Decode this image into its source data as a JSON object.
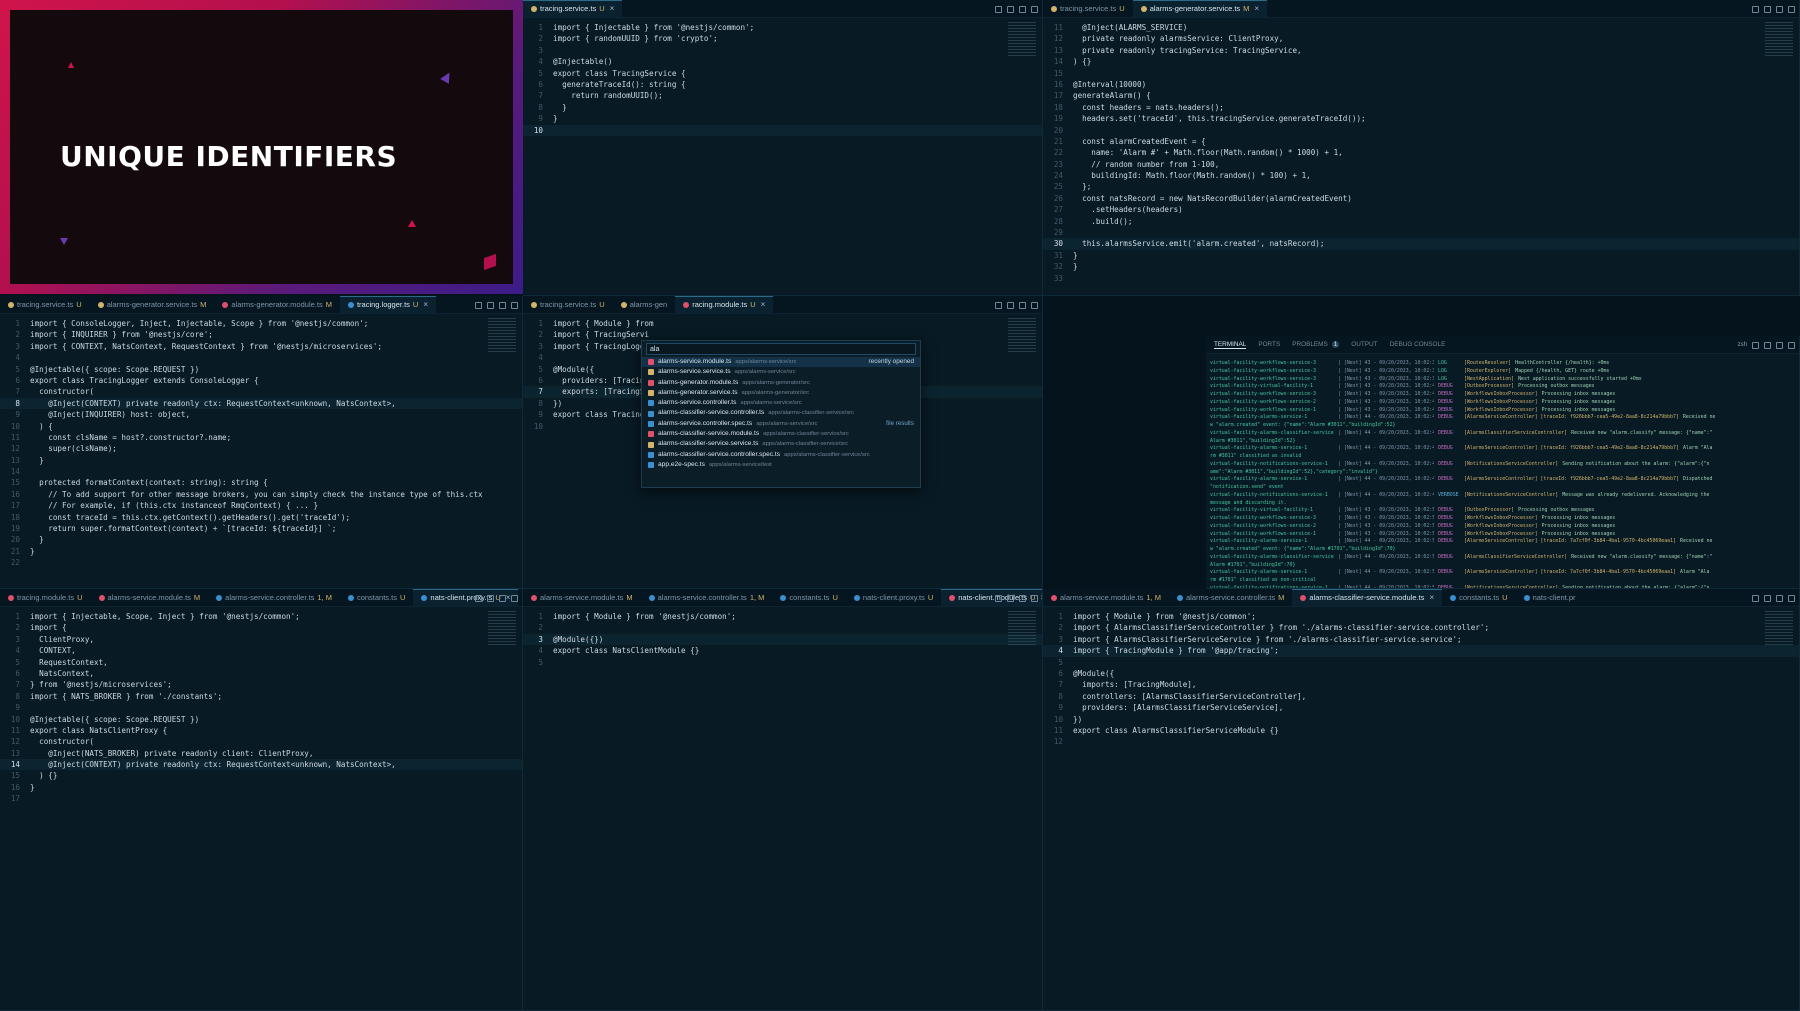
{
  "video": {
    "title": "UNIQUE IDENTIFIERS"
  },
  "panes": [
    {
      "id": "p1",
      "tabs": [
        {
          "label": "tracing.service.ts",
          "badge": "U",
          "active": true,
          "icon": "#d5b36a",
          "close": true
        }
      ],
      "active_line": 10,
      "lines": [
        "import { Injectable } from '@nestjs/common';",
        "import { randomUUID } from 'crypto';",
        "",
        "@Injectable()",
        "export class TracingService {",
        "  generateTraceId(): string {",
        "    return randomUUID();",
        "  }",
        "}",
        ""
      ]
    },
    {
      "id": "p2",
      "tabs": [
        {
          "label": "tracing.service.ts",
          "badge": "U",
          "active": false,
          "icon": "#d5b36a"
        },
        {
          "label": "alarms-generator.service.ts",
          "badge": "M",
          "active": true,
          "icon": "#d5b36a",
          "close": true
        }
      ],
      "start": 11,
      "active_line": 30,
      "lines": [
        "  @Inject(ALARMS_SERVICE)",
        "  private readonly alarmsService: ClientProxy,",
        "  private readonly tracingService: TracingService,",
        ") {}",
        "",
        "@Interval(10000)",
        "generateAlarm() {",
        "  const headers = nats.headers();",
        "  headers.set('traceId', this.tracingService.generateTraceId());",
        "",
        "  const alarmCreatedEvent = {",
        "    name: 'Alarm #' + Math.floor(Math.random() * 1000) + 1,",
        "    // random number from 1-100,",
        "    buildingId: Math.floor(Math.random() * 100) + 1,",
        "  };",
        "  const natsRecord = new NatsRecordBuilder(alarmCreatedEvent)",
        "    .setHeaders(headers)",
        "    .build();",
        "",
        "  this.alarmsService.emit('alarm.created', natsRecord);",
        "}",
        "}",
        ""
      ]
    },
    {
      "id": "p3",
      "tabs": [
        {
          "label": "tracing.service.ts",
          "badge": "U",
          "active": false,
          "icon": "#d5b36a"
        },
        {
          "label": "alarms-generator.service.ts",
          "badge": "M",
          "active": false,
          "icon": "#d5b36a"
        },
        {
          "label": "alarms-generator.module.ts",
          "badge": "M",
          "active": false,
          "icon": "#e0506a"
        },
        {
          "label": "tracing.logger.ts",
          "badge": "U",
          "active": true,
          "icon": "#3a8fd0",
          "close": true
        }
      ],
      "active_line": 8,
      "lines": [
        "import { ConsoleLogger, Inject, Injectable, Scope } from '@nestjs/common';",
        "import { INQUIRER } from '@nestjs/core';",
        "import { CONTEXT, NatsContext, RequestContext } from '@nestjs/microservices';",
        "",
        "@Injectable({ scope: Scope.REQUEST })",
        "export class TracingLogger extends ConsoleLogger {",
        "  constructor(",
        "    @Inject(CONTEXT) private readonly ctx: RequestContext<unknown, NatsContext>,",
        "    @Inject(INQUIRER) host: object,",
        "  ) {",
        "    const clsName = host?.constructor?.name;",
        "    super(clsName);",
        "  }",
        "",
        "  protected formatContext(context: string): string {",
        "    // To add support for other message brokers, you can simply check the instance type of this.ctx",
        "    // For example, if (this.ctx instanceof RmqContext) { ... }",
        "    const traceId = this.ctx.getContext().getHeaders().get('traceId');",
        "    return super.formatContext(context) + `[traceId: ${traceId}] `;",
        "  }",
        "}",
        ""
      ]
    },
    {
      "id": "p4",
      "tabs": [
        {
          "label": "tracing.service.ts",
          "badge": "U",
          "active": false,
          "icon": "#d5b36a"
        },
        {
          "label": "alarms-gen",
          "badge": "",
          "active": false,
          "icon": "#d5b36a"
        },
        {
          "label": "racing.module.ts",
          "badge": "U",
          "active": true,
          "icon": "#e0506a",
          "close": true
        }
      ],
      "active_line": 7,
      "lines": [
        "import { Module } from",
        "import { TracingServi",
        "import { TracingLogge",
        "",
        "@Module({",
        "  providers: [Tracing",
        "  exports: [TracingSe",
        "})",
        "export class TracingMo",
        ""
      ]
    },
    {
      "id": "p5",
      "tabs": [
        {
          "label": "tracing.module.ts",
          "badge": "U",
          "active": false,
          "icon": "#e0506a"
        },
        {
          "label": "alarms-service.module.ts",
          "badge": "M",
          "active": false,
          "icon": "#e0506a"
        },
        {
          "label": "alarms-service.controller.ts",
          "badge": "1, M",
          "active": false,
          "icon": "#3a8fd0"
        },
        {
          "label": "constants.ts",
          "badge": "U",
          "active": false,
          "icon": "#3a8fd0"
        },
        {
          "label": "nats-client.proxy.ts",
          "badge": "U",
          "active": true,
          "icon": "#3a8fd0",
          "close": true
        }
      ],
      "active_line": 14,
      "lines": [
        "import { Injectable, Scope, Inject } from '@nestjs/common';",
        "import {",
        "  ClientProxy,",
        "  CONTEXT,",
        "  RequestContext,",
        "  NatsContext,",
        "} from '@nestjs/microservices';",
        "import { NATS_BROKER } from './constants';",
        "",
        "@Injectable({ scope: Scope.REQUEST })",
        "export class NatsClientProxy {",
        "  constructor(",
        "    @Inject(NATS_BROKER) private readonly client: ClientProxy,",
        "    @Inject(CONTEXT) private readonly ctx: RequestContext<unknown, NatsContext>,",
        "  ) {}",
        "}",
        ""
      ]
    },
    {
      "id": "p6",
      "tabs": [
        {
          "label": "alarms-service.module.ts",
          "badge": "M",
          "active": false,
          "icon": "#e0506a"
        },
        {
          "label": "alarms-service.controller.ts",
          "badge": "1, M",
          "active": false,
          "icon": "#3a8fd0"
        },
        {
          "label": "constants.ts",
          "badge": "U",
          "active": false,
          "icon": "#3a8fd0"
        },
        {
          "label": "nats-client.proxy.ts",
          "badge": "U",
          "active": false,
          "icon": "#3a8fd0"
        },
        {
          "label": "nats-client.module.ts",
          "badge": "U",
          "active": true,
          "icon": "#e0506a",
          "close": true
        }
      ],
      "active_line": 3,
      "lines": [
        "import { Module } from '@nestjs/common';",
        "",
        "@Module({})",
        "export class NatsClientModule {}",
        ""
      ]
    },
    {
      "id": "p7",
      "tabs": [
        {
          "label": "alarms-service.module.ts",
          "badge": "1, M",
          "active": false,
          "icon": "#e0506a"
        },
        {
          "label": "alarms-service.controller.ts",
          "badge": "M",
          "active": false,
          "icon": "#3a8fd0"
        },
        {
          "label": "alarms-classifier-service.module.ts",
          "badge": "",
          "active": true,
          "icon": "#e0506a",
          "close": true
        },
        {
          "label": "constants.ts",
          "badge": "U",
          "active": false,
          "icon": "#3a8fd0"
        },
        {
          "label": "nats-client.pr",
          "badge": "",
          "active": false,
          "icon": "#3a8fd0"
        }
      ],
      "active_line": 4,
      "lines": [
        "import { Module } from '@nestjs/common';",
        "import { AlarmsClassifierServiceController } from './alarms-classifier-service.controller';",
        "import { AlarmsClassifierServiceService } from './alarms-classifier-service.service';",
        "import { TracingModule } from '@app/tracing';",
        "",
        "@Module({",
        "  imports: [TracingModule],",
        "  controllers: [AlarmsClassifierServiceController],",
        "  providers: [AlarmsClassifierServiceService],",
        "})",
        "export class AlarmsClassifierServiceModule {}",
        ""
      ]
    }
  ],
  "quick_open": {
    "query": "ala",
    "recent_label": "recently opened",
    "file_results_label": "file results",
    "items": [
      {
        "name": "alarms-service.module.ts",
        "path": "apps/alarms-service/src",
        "icon": "#e0506a"
      },
      {
        "name": "alarms-service.service.ts",
        "path": "apps/alarms-service/src",
        "icon": "#d5b36a"
      },
      {
        "name": "alarms-generator.module.ts",
        "path": "apps/alarms-generator/src",
        "icon": "#e0506a"
      },
      {
        "name": "alarms-generator.service.ts",
        "path": "apps/alarms-generator/src",
        "icon": "#d5b36a"
      },
      {
        "name": "alarms-service.controller.ts",
        "path": "apps/alarms-service/src",
        "icon": "#3a8fd0"
      },
      {
        "name": "alarms-classifier-service.controller.ts",
        "path": "apps/alarms-classifier-service/src",
        "icon": "#3a8fd0"
      },
      {
        "name": "alarms-service.controller.spec.ts",
        "path": "apps/alarms-service/src",
        "icon": "#3a8fd0"
      },
      {
        "name": "alarms-classifier-service.module.ts",
        "path": "apps/alarms-classifier-service/src",
        "icon": "#e0506a"
      },
      {
        "name": "alarms-classifier-service.service.ts",
        "path": "apps/alarms-classifier-service/src",
        "icon": "#d5b36a"
      },
      {
        "name": "alarms-classifier-service.controller.spec.ts",
        "path": "apps/alarms-classifier-service/src",
        "icon": "#3a8fd0"
      },
      {
        "name": "app.e2e-spec.ts",
        "path": "apps/alarms-service/test",
        "icon": "#3a8fd0"
      }
    ]
  },
  "terminal": {
    "tabs": [
      "TERMINAL",
      "PORTS",
      "PROBLEMS",
      "OUTPUT",
      "DEBUG CONSOLE"
    ],
    "problems_count": "1",
    "shell": "zsh",
    "lines": [
      {
        "svc": "virtual-facility-workflows-service-3",
        "meta": "| [Nest] 43 - 09/20/2023, 10:02:38 AM",
        "lvl": "LOG",
        "ctx": "[RoutesResolver]",
        "msg": "HealthController {/health}: +0ms"
      },
      {
        "svc": "virtual-facility-workflows-service-3",
        "meta": "| [Nest] 43 - 09/20/2023, 10:02:38 AM",
        "lvl": "LOG",
        "ctx": "[RouterExplorer]",
        "msg": "Mapped {/health, GET} route +0ms"
      },
      {
        "svc": "virtual-facility-workflows-service-3",
        "meta": "| [Nest] 43 - 09/20/2023, 10:02:38 AM",
        "lvl": "LOG",
        "ctx": "[NestApplication]",
        "msg": "Nest application successfully started +0ms"
      },
      {
        "svc": "virtual-facility-virtual-facility-1",
        "meta": "| [Nest] 43 - 09/20/2023, 10:02:40 AM",
        "lvl": "DEBUG",
        "ctx": "[OutboxProcessor]",
        "msg": "Processing outbox messages"
      },
      {
        "svc": "virtual-facility-workflows-service-3",
        "meta": "| [Nest] 43 - 09/20/2023, 10:02:40 AM",
        "lvl": "DEBUG",
        "ctx": "[WorkflowsInboxProcessor]",
        "msg": "Processing inbox messages"
      },
      {
        "svc": "virtual-facility-workflows-service-2",
        "meta": "| [Nest] 43 - 09/20/2023, 10:02:40 AM",
        "lvl": "DEBUG",
        "ctx": "[WorkflowsInboxProcessor]",
        "msg": "Processing inbox messages"
      },
      {
        "svc": "virtual-facility-workflows-service-1",
        "meta": "| [Nest] 43 - 09/20/2023, 10:02:40 AM",
        "lvl": "DEBUG",
        "ctx": "[WorkflowsInboxProcessor]",
        "msg": "Processing inbox messages"
      },
      {
        "svc": "virtual-facility-alarms-service-1",
        "meta": "| [Nest] 44 - 09/20/2023, 10:02:44 AM",
        "lvl": "DEBUG",
        "ctx": "[AlarmsServiceController] [traceId: f926bbb7-cea5-49e2-8aa8-8c214a79bbb7]",
        "msg": "Received ne"
      },
      {
        "cont": true,
        "svc": "",
        "meta": "",
        "lvl": "",
        "ctx": "",
        "msg": "w \"alarm.created\" event: {\"name\":\"Alarm #3011\",\"buildingId\":52}"
      },
      {
        "svc": "virtual-facility-alarms-classifier-service-1",
        "meta": "| [Nest] 44 - 09/20/2023, 10:02:44 AM",
        "lvl": "DEBUG",
        "ctx": "[AlarmsClassifierServiceController]",
        "msg": "Received new \"alarm.classify\" message: {\"name\":\""
      },
      {
        "cont": true,
        "svc": "",
        "meta": "",
        "lvl": "",
        "ctx": "",
        "msg": "Alarm #3011\",\"buildingId\":52}"
      },
      {
        "svc": "virtual-facility-alarms-service-1",
        "meta": "| [Nest] 44 - 09/20/2023, 10:02:44 AM",
        "lvl": "DEBUG",
        "ctx": "[AlarmsServiceController] [traceId: f926bbb7-cea5-49e2-8aa8-8c214a79bbb7]",
        "msg": "Alarm \"Ala"
      },
      {
        "cont": true,
        "svc": "",
        "meta": "",
        "lvl": "",
        "ctx": "",
        "msg": "rm #3011\" classified as invalid"
      },
      {
        "svc": "virtual-facility-notifications-service-1",
        "meta": "| [Nest] 44 - 09/20/2023, 10:02:44 AM",
        "lvl": "DEBUG",
        "ctx": "[NotificationsServiceController]",
        "msg": "Sending notification about the alarm: {\"alarm\":{\"n"
      },
      {
        "cont": true,
        "svc": "",
        "meta": "",
        "lvl": "",
        "ctx": "",
        "msg": "ame\":\"Alarm #3011\",\"buildingId\":52},\"category\":\"invalid\"}"
      },
      {
        "svc": "virtual-facility-alarms-service-1",
        "meta": "| [Nest] 44 - 09/20/2023, 10:02:44 AM",
        "lvl": "DEBUG",
        "ctx": "[AlarmsServiceController] [traceId: f926bbb7-cea5-49e2-8aa8-8c214a79bbb7]",
        "msg": "Dispatched"
      },
      {
        "cont": true,
        "svc": "",
        "meta": "",
        "lvl": "",
        "ctx": "",
        "msg": "\"notification.send\" event"
      },
      {
        "svc": "virtual-facility-notifications-service-1",
        "meta": "| [Nest] 44 - 09/20/2023, 10:02:44 AM",
        "lvl": "VERBOSE",
        "ctx": "[NotificationsServiceController]",
        "msg": "Message was already redelivered. Acknowledging the"
      },
      {
        "cont": true,
        "svc": "",
        "meta": "",
        "lvl": "",
        "ctx": "",
        "msg": "message and discarding it."
      },
      {
        "svc": "virtual-facility-virtual-facility-1",
        "meta": "| [Nest] 43 - 09/20/2023, 10:02:50 AM",
        "lvl": "DEBUG",
        "ctx": "[OutboxProcessor]",
        "msg": "Processing outbox messages"
      },
      {
        "svc": "virtual-facility-workflows-service-3",
        "meta": "| [Nest] 43 - 09/20/2023, 10:02:50 AM",
        "lvl": "DEBUG",
        "ctx": "[WorkflowsInboxProcessor]",
        "msg": "Processing inbox messages"
      },
      {
        "svc": "virtual-facility-workflows-service-2",
        "meta": "| [Nest] 43 - 09/20/2023, 10:02:50 AM",
        "lvl": "DEBUG",
        "ctx": "[WorkflowsInboxProcessor]",
        "msg": "Processing inbox messages"
      },
      {
        "svc": "virtual-facility-workflows-service-1",
        "meta": "| [Nest] 43 - 09/20/2023, 10:02:50 AM",
        "lvl": "DEBUG",
        "ctx": "[WorkflowsInboxProcessor]",
        "msg": "Processing inbox messages"
      },
      {
        "svc": "virtual-facility-alarms-service-1",
        "meta": "| [Nest] 44 - 09/20/2023, 10:02:54 AM",
        "lvl": "DEBUG",
        "ctx": "[AlarmsServiceController] [traceId: 7a7cf0f-3b84-4ba1-9570-4bc45069eaa1]",
        "msg": "Received ne"
      },
      {
        "cont": true,
        "svc": "",
        "meta": "",
        "lvl": "",
        "ctx": "",
        "msg": "w \"alarm.created\" event: {\"name\":\"Alarm #1701\",\"buildingId\":70}"
      },
      {
        "svc": "virtual-facility-alarms-classifier-service-1",
        "meta": "| [Nest] 44 - 09/20/2023, 10:02:54 AM",
        "lvl": "DEBUG",
        "ctx": "[AlarmsClassifierServiceController]",
        "msg": "Received new \"alarm.classify\" message: {\"name\":\""
      },
      {
        "cont": true,
        "svc": "",
        "meta": "",
        "lvl": "",
        "ctx": "",
        "msg": "Alarm #1701\",\"buildingId\":70}"
      },
      {
        "svc": "virtual-facility-alarms-service-1",
        "meta": "| [Nest] 44 - 09/20/2023, 10:02:54 AM",
        "lvl": "DEBUG",
        "ctx": "[AlarmsServiceController] [traceId: 7a7cf0f-3b84-4ba1-9570-4bc45069eaa1]",
        "msg": "Alarm \"Ala"
      },
      {
        "cont": true,
        "svc": "",
        "meta": "",
        "lvl": "",
        "ctx": "",
        "msg": "rm #1701\" classified as non-critical"
      },
      {
        "svc": "virtual-facility-notifications-service-1",
        "meta": "| [Nest] 44 - 09/20/2023, 10:02:54 AM",
        "lvl": "DEBUG",
        "ctx": "[NotificationsServiceController]",
        "msg": "Sending notification about the alarm: {\"alarm\":{\"n"
      },
      {
        "cont": true,
        "svc": "",
        "meta": "",
        "lvl": "",
        "ctx": "",
        "msg": "ame\":\"Alarm #1701\",\"buildingId\":70},\"category\":\"non-critical\"}"
      },
      {
        "svc": "virtual-facility-alarms-service-1",
        "meta": "| [Nest] 44 - 09/20/2023, 10:02:54 AM",
        "lvl": "DEBUG",
        "ctx": "[AlarmsServiceController] [traceId: 7a7cf0f-3b84-4ba1-9570-4bc45069eaa1]",
        "msg": "Dispatched"
      },
      {
        "cont": true,
        "svc": "",
        "meta": "",
        "lvl": "",
        "ctx": "",
        "msg": "\"notification.send\" event"
      },
      {
        "svc": "virtual-facility-notifications-service-1",
        "meta": "| [Nest] 44 - 09/20/2023, 10:02:54 AM",
        "lvl": "VERBOSE",
        "ctx": "[NotificationsServiceController]",
        "msg": "Message was already redelivered. Acknowledging the"
      },
      {
        "cont": true,
        "svc": "",
        "meta": "",
        "lvl": "",
        "ctx": "",
        "msg": "message and discarding it."
      }
    ]
  }
}
